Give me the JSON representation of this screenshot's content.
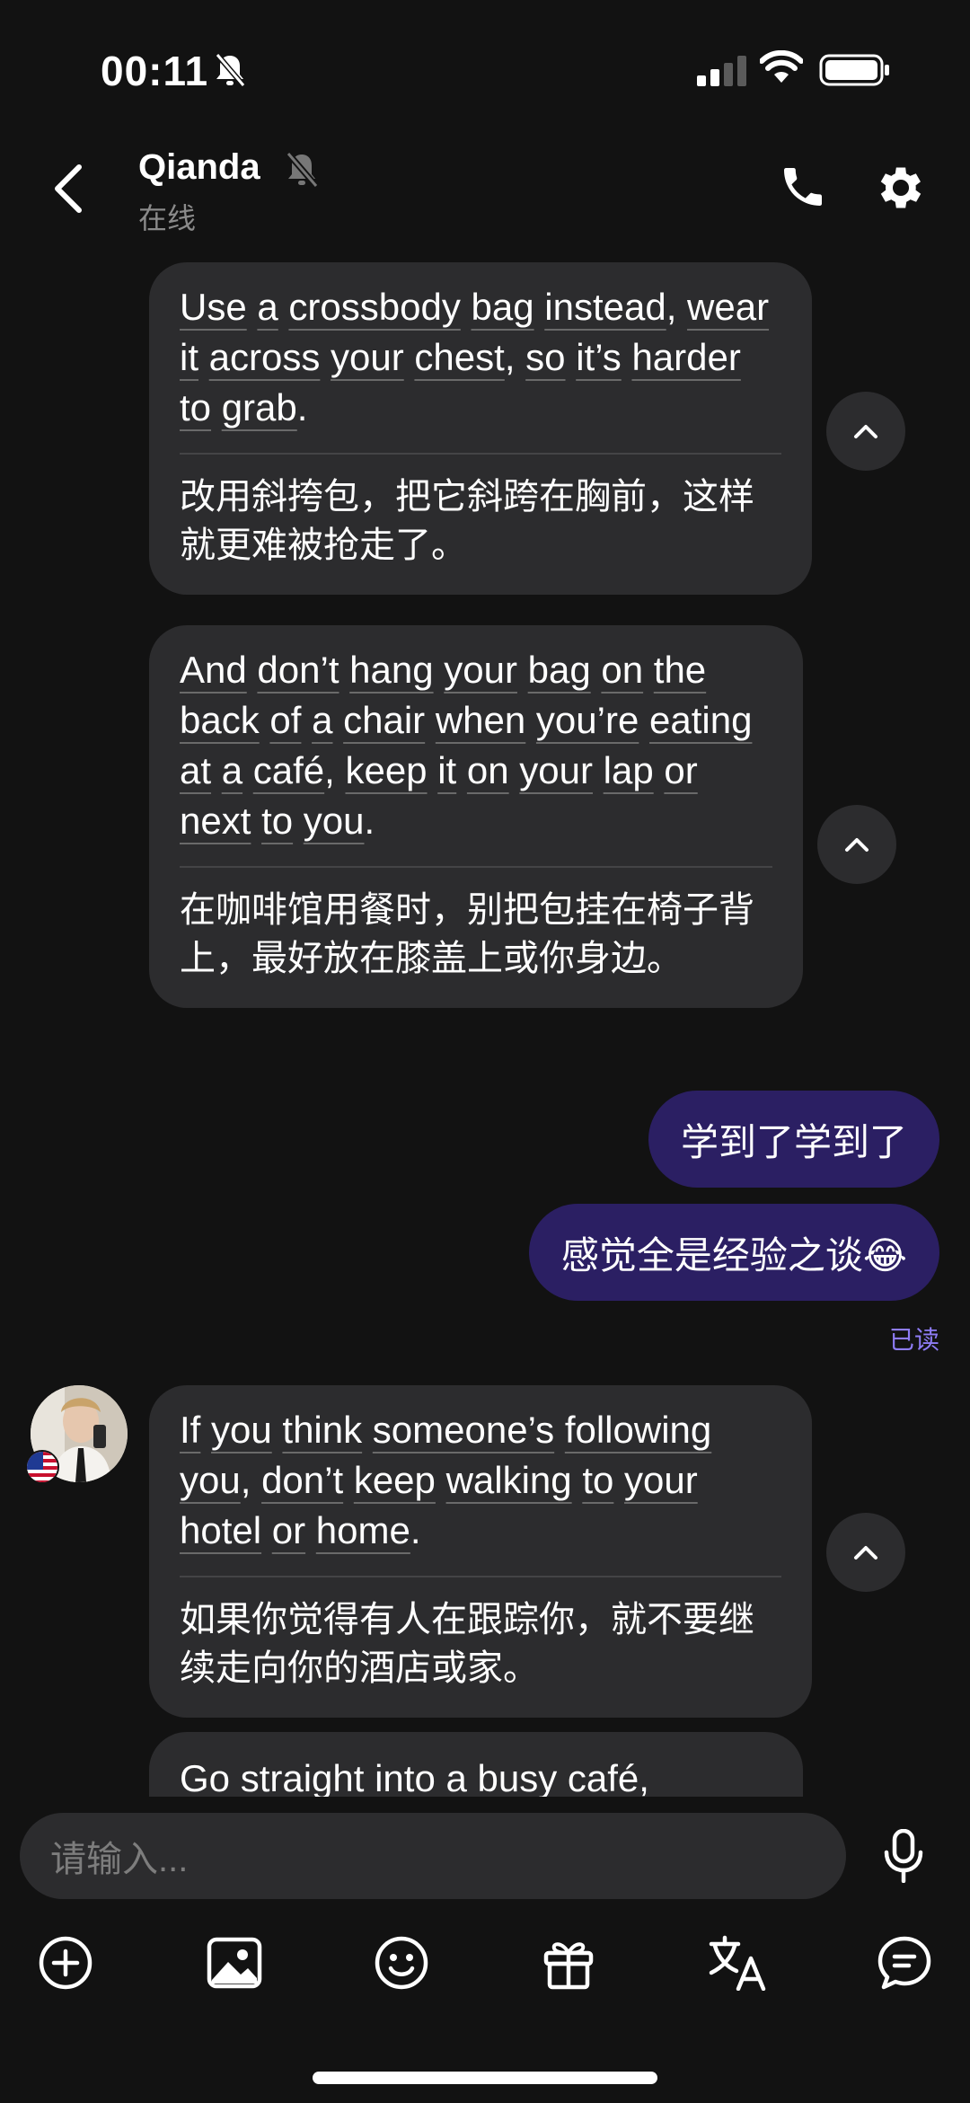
{
  "status_bar": {
    "time": "00:11"
  },
  "header": {
    "contact_name": "Qianda",
    "contact_status": "在线"
  },
  "messages": [
    {
      "en_words": [
        "Use",
        "a",
        "crossbody",
        "bag",
        "instead,",
        "wear",
        "it",
        "across",
        "your",
        "chest,",
        "so",
        "it’s",
        "harder",
        "to",
        "grab."
      ],
      "zh": "改用斜挎包，把它斜跨在胸前，这样就更难被抢走了。"
    },
    {
      "en_words": [
        "And",
        "don’t",
        "hang",
        "your",
        "bag",
        "on",
        "the",
        "back",
        "of",
        "a",
        "chair",
        "when",
        "you’re",
        "eating",
        "at",
        "a",
        "café,",
        "keep",
        "it",
        "on",
        "your",
        "lap",
        "or",
        "next",
        "to",
        "you."
      ],
      "zh": "在咖啡馆用餐时，别把包挂在椅子背上，最好放在膝盖上或你身边。"
    },
    {
      "out": "学到了学到了"
    },
    {
      "out": "感觉全是经验之谈😂"
    },
    {
      "read": "已读"
    },
    {
      "en_words": [
        "If",
        "you",
        "think",
        "someone’s",
        "following",
        "you,",
        "don’t",
        "keep",
        "walking",
        "to",
        "your",
        "hotel",
        "or",
        "home."
      ],
      "zh": "如果你觉得有人在跟踪你，就不要继续走向你的酒店或家。"
    },
    {
      "partial": "Go straight into a busy café,"
    }
  ],
  "input": {
    "placeholder": "请输入..."
  },
  "toolbar": [
    "plus-icon",
    "image-icon",
    "emoji-icon",
    "gift-icon",
    "translate-icon",
    "chat-icon"
  ],
  "colors": {
    "bubble_in": "#2c2c2e",
    "bubble_out": "#2b1f63",
    "read": "#8e7cf5",
    "background": "#121212"
  }
}
